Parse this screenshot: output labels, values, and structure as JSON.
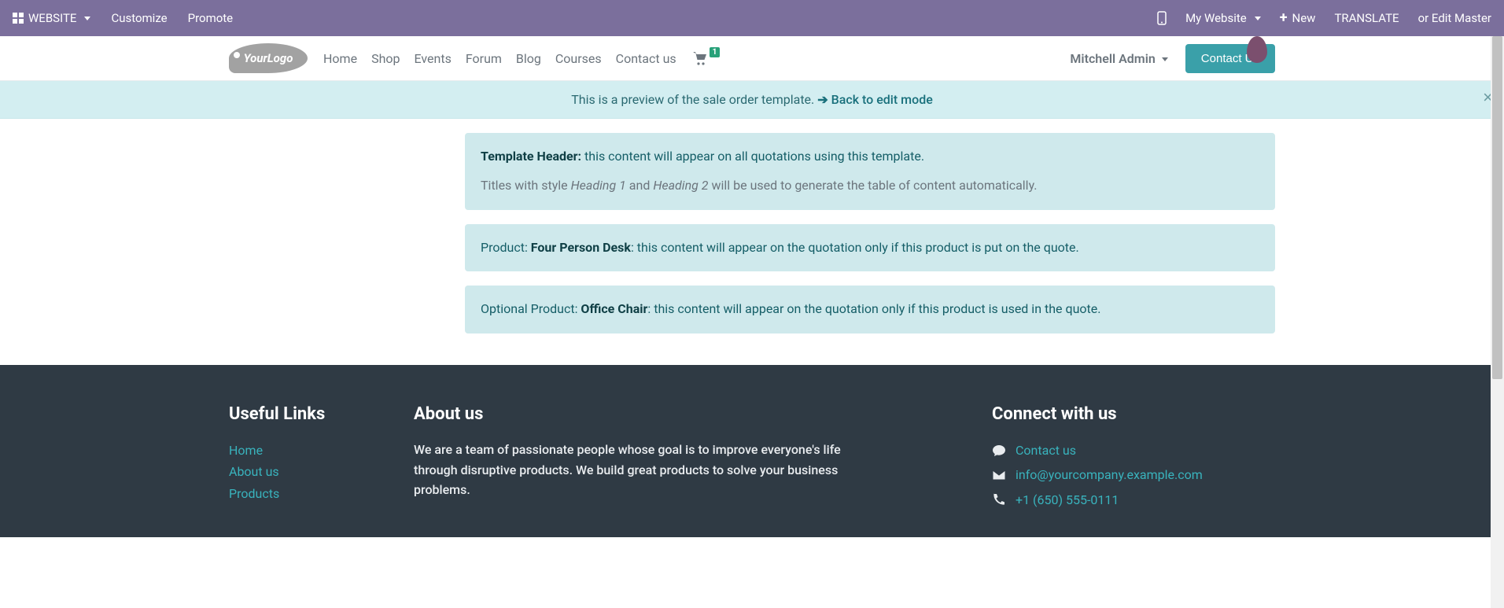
{
  "topbar": {
    "website_label": "WEBSITE",
    "customize": "Customize",
    "promote": "Promote",
    "my_website": "My Website",
    "new": "New",
    "translate": "TRANSLATE",
    "edit_master": "or Edit Master"
  },
  "header": {
    "logo_text": "YourLogo",
    "nav": [
      "Home",
      "Shop",
      "Events",
      "Forum",
      "Blog",
      "Courses",
      "Contact us"
    ],
    "cart_count": "1",
    "user_name": "Mitchell Admin",
    "contact_btn": "Contact Us"
  },
  "alert": {
    "text": "This is a preview of the sale order template. ",
    "link": "Back to edit mode"
  },
  "boxes": {
    "b1_strong": "Template Header:",
    "b1_rest": " this content will appear on all quotations using this template.",
    "b1_hint_a": "Titles with style ",
    "b1_hint_i1": "Heading 1",
    "b1_hint_mid": " and ",
    "b1_hint_i2": "Heading 2",
    "b1_hint_b": " will be used to generate the table of content automatically.",
    "b2_pre": "Product: ",
    "b2_strong": "Four Person Desk",
    "b2_rest": ": this content will appear on the quotation only if this product is put on the quote.",
    "b3_pre": "Optional Product: ",
    "b3_strong": "Office Chair",
    "b3_rest": ": this content will appear on the quotation only if this product is used in the quote."
  },
  "footer": {
    "useful_title": "Useful Links",
    "links": [
      "Home",
      "About us",
      "Products"
    ],
    "about_title": "About us",
    "about_text": "We are a team of passionate people whose goal is to improve everyone's life through disruptive products. We build great products to solve your business problems.",
    "connect_title": "Connect with us",
    "contact_us": "Contact us",
    "email": "info@yourcompany.example.com",
    "phone": "+1 (650) 555-0111"
  }
}
